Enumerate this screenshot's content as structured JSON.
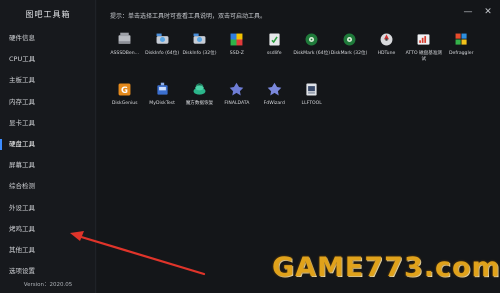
{
  "app": {
    "title": "图吧工具箱",
    "version": "Version：2020.05"
  },
  "sidebar": {
    "items": [
      {
        "label": "硬件信息",
        "active": false
      },
      {
        "label": "CPU工具",
        "active": false
      },
      {
        "label": "主板工具",
        "active": false
      },
      {
        "label": "内存工具",
        "active": false
      },
      {
        "label": "显卡工具",
        "active": false
      },
      {
        "label": "硬盘工具",
        "active": true
      },
      {
        "label": "屏幕工具",
        "active": false
      },
      {
        "label": "综合检测",
        "active": false
      },
      {
        "label": "外设工具",
        "active": false
      },
      {
        "label": "烤鸡工具",
        "active": false
      },
      {
        "label": "其他工具",
        "active": false
      },
      {
        "label": "选项设置",
        "active": false
      }
    ]
  },
  "main": {
    "hint": "提示：单击选择工具时可查看工具说明，双击可启动工具。",
    "window_controls": {
      "minimize": "—",
      "close": "✕"
    },
    "tools": [
      {
        "label": "ASSSDBen...",
        "icon": "ssd-drive-icon"
      },
      {
        "label": "DiskInfo (64位)",
        "icon": "diskinfo-64-icon"
      },
      {
        "label": "DiskInfo (32位)",
        "icon": "diskinfo-32-icon"
      },
      {
        "label": "SSD-Z",
        "icon": "ssd-z-icon"
      },
      {
        "label": "ssdlife",
        "icon": "ssdlife-icon"
      },
      {
        "label": "DiskMark (64位)",
        "icon": "diskmark-64-icon"
      },
      {
        "label": "DiskMark (32位)",
        "icon": "diskmark-32-icon"
      },
      {
        "label": "HDTune",
        "icon": "hdtune-icon"
      },
      {
        "label": "ATTO 磁盘基准测试",
        "icon": "atto-icon"
      },
      {
        "label": "Defraggler",
        "icon": "defraggler-icon"
      },
      {
        "label": "DiskGenius",
        "icon": "diskgenius-icon"
      },
      {
        "label": "MyDiskTest",
        "icon": "mydisktest-icon"
      },
      {
        "label": "魔方数据恢复",
        "icon": "data-recovery-icon"
      },
      {
        "label": "FINALDATA",
        "icon": "finaldata-icon"
      },
      {
        "label": "FdWizard",
        "icon": "fdwizard-icon"
      },
      {
        "label": "LLFTOOL",
        "icon": "llftool-icon"
      }
    ]
  },
  "watermark": {
    "text": "GAME773.com"
  },
  "colors": {
    "accent": "#3c8cff",
    "arrow": "#e0342a",
    "background": "#141619",
    "watermark": "#e0a21b"
  }
}
